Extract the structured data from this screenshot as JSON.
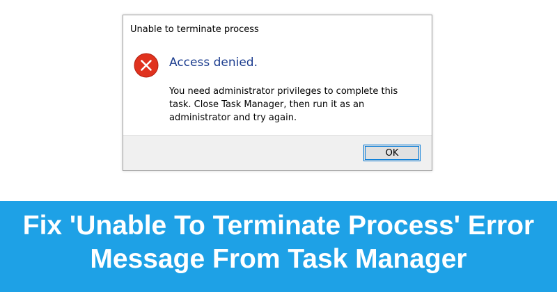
{
  "dialog": {
    "title": "Unable to terminate process",
    "main_instruction": "Access denied.",
    "content": "You need administrator privileges to complete this task. Close Task Manager, then run it as an administrator and try again.",
    "ok_label": "OK",
    "icon": "error-icon"
  },
  "banner": {
    "line1": "Fix 'Unable To Terminate Process' Error",
    "line2": "Message From Task Manager"
  },
  "colors": {
    "banner_background": "#1ea1e6",
    "error_red": "#e0321e",
    "instruction_blue": "#1c3d8f",
    "button_focus": "#0078d7"
  }
}
